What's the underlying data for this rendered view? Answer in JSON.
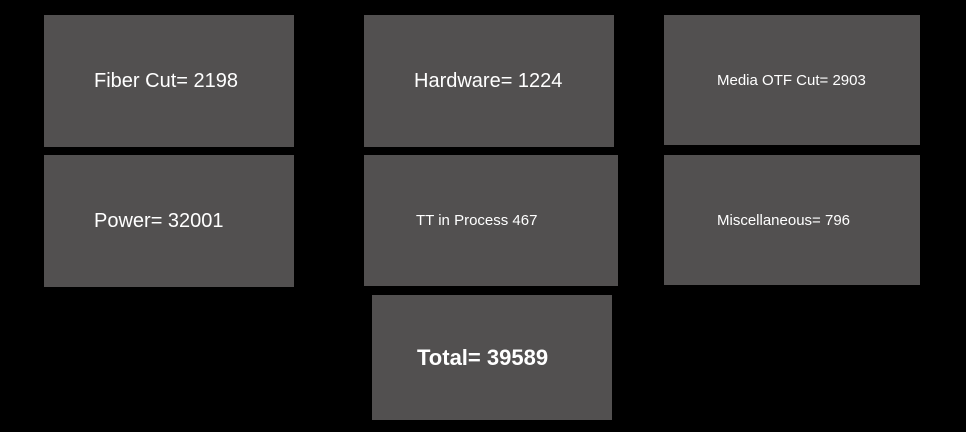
{
  "tiles": {
    "fiber_cut": "Fiber Cut= 2198",
    "hardware": "Hardware= 1224",
    "media_otf_cut": "Media OTF Cut= 2903",
    "power": "Power= 32001",
    "tt_in_process": "TT in Process 467",
    "miscellaneous": "Miscellaneous= 796",
    "total": "Total= 39589"
  },
  "colors": {
    "background": "#000000",
    "tile": "#525050",
    "text": "#ffffff"
  }
}
